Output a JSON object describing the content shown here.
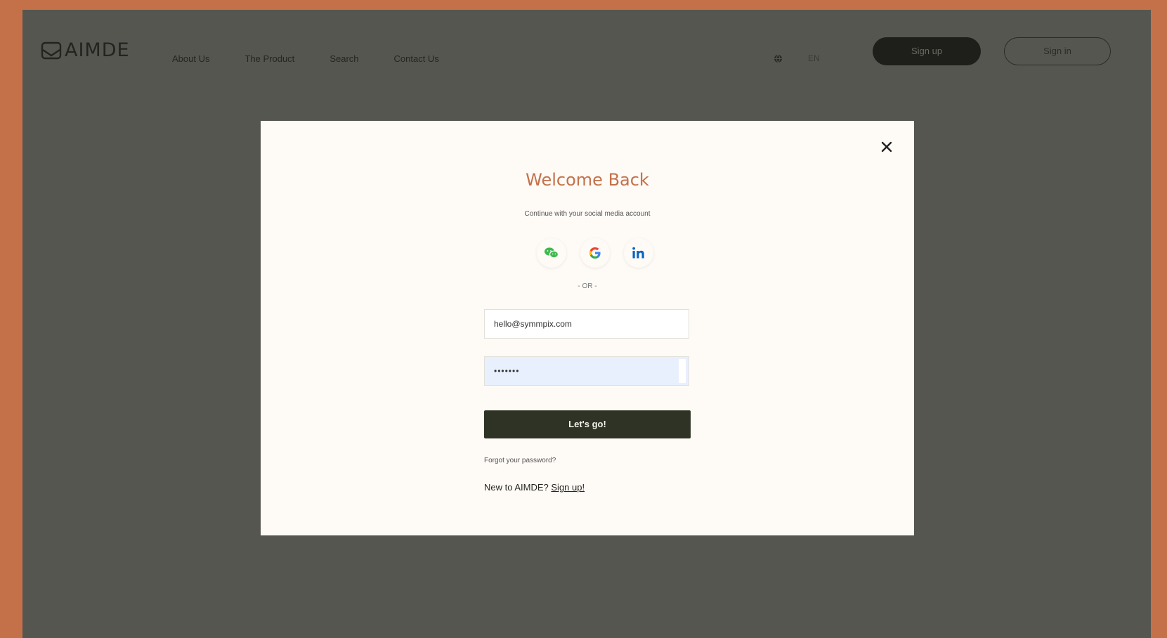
{
  "header": {
    "logo": "AIMDE",
    "nav": [
      "About Us",
      "The Product",
      "Search",
      "Contact Us"
    ],
    "language": "EN",
    "signup_label": "Sign up",
    "signin_label": "Sign in"
  },
  "modal": {
    "title": "Welcome Back",
    "subtitle": "Continue with your social media account",
    "socials": [
      "wechat-icon",
      "google-icon",
      "linkedin-icon"
    ],
    "or_label": "- OR -",
    "email_value": "hello@symmpix.com",
    "password_value": "•••••••",
    "submit_label": "Let's go!",
    "forgot_label": "Forgot your password?",
    "new_prefix": "New to AIMDE?",
    "new_link": "Sign up!"
  },
  "colors": {
    "outer_background": "#c4714a",
    "overlay": "#565651",
    "modal_background": "#fefaf6",
    "title_accent": "#c4714a",
    "submit_button": "#2e3325"
  }
}
